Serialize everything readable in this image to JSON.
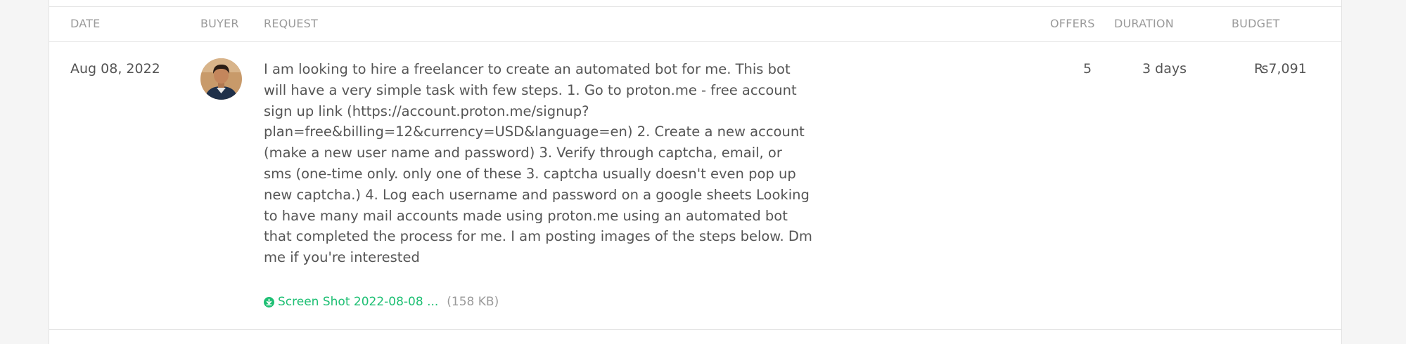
{
  "table": {
    "headers": {
      "date": "DATE",
      "buyer": "BUYER",
      "request": "REQUEST",
      "offers": "OFFERS",
      "duration": "DURATION",
      "budget": "BUDGET"
    },
    "rows": [
      {
        "date": "Aug 08, 2022",
        "buyer_avatar": "avatar-icon",
        "request": "I am looking to hire a freelancer to create an automated bot for me. This bot will have a very simple task with few steps. 1. Go to proton.me - free account sign up link (https://account.proton.me/signup?plan=free&billing=12&currency=USD&language=en) 2. Create a new account (make a new user name and password) 3. Verify through captcha, email, or sms (one-time only. only one of these 3. captcha usually doesn't even pop up new captcha.) 4. Log each username and password on a google sheets Looking to have many mail accounts made using proton.me using an automated bot that completed the process for me. I am posting images of the steps below. Dm me if you're interested",
        "attachment": {
          "name": "Screen Shot 2022-08-08 ...",
          "size": "(158 KB)",
          "icon": "download-circle-icon"
        },
        "offers": "5",
        "duration": "3 days",
        "budget": "₨7,091"
      }
    ]
  },
  "colors": {
    "accent": "#1dbf73",
    "text": "#555555",
    "muted": "#9a9a9a",
    "background": "#f5f5f5"
  }
}
